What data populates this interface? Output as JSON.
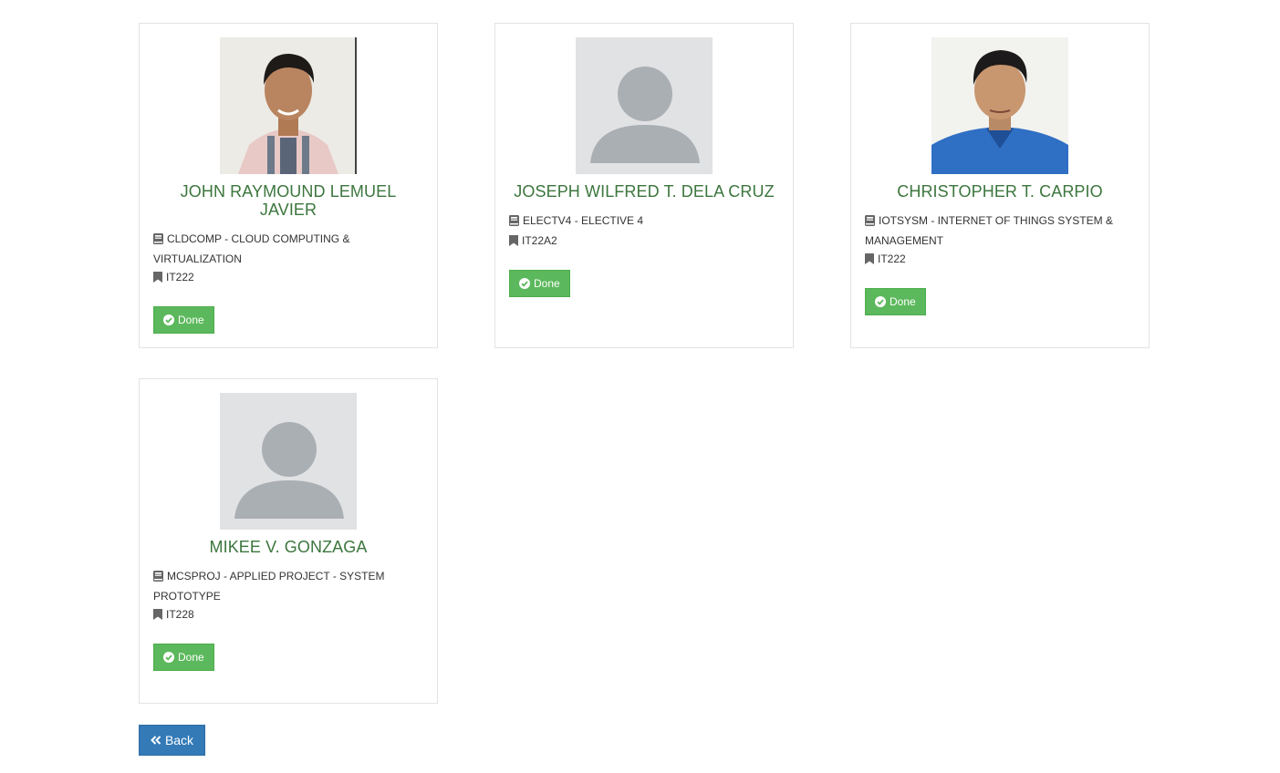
{
  "cards": [
    {
      "photo": "photo-man-striped-shirt",
      "name": "JOHN RAYMOUND LEMUEL JAVIER",
      "course": "CLDCOMP - CLOUD COMPUTING & VIRTUALIZATION",
      "section": "IT222",
      "status": "Done"
    },
    {
      "photo": "default-avatar",
      "name": "JOSEPH WILFRED T. DELA CRUZ",
      "course": "ELECTV4 - ELECTIVE 4",
      "section": "IT22A2",
      "status": "Done"
    },
    {
      "photo": "photo-man-blue-polo",
      "name": "CHRISTOPHER T. CARPIO",
      "course": "IOTSYSM - INTERNET OF THINGS SYSTEM & MANAGEMENT",
      "section": "IT222",
      "status": "Done"
    },
    {
      "photo": "default-avatar",
      "name": "MIKEE V. GONZAGA",
      "course": "MCSPROJ - APPLIED PROJECT - SYSTEM PROTOTYPE",
      "section": "IT228",
      "status": "Done"
    }
  ],
  "back_label": "Back",
  "icons": {
    "course": "book-icon",
    "section": "bookmark-icon",
    "status": "check-circle-icon",
    "back": "double-chevron-left-icon"
  },
  "colors": {
    "name": "#3c763d",
    "done": "#5cb85c",
    "back": "#337ab7",
    "icon": "#666666"
  }
}
